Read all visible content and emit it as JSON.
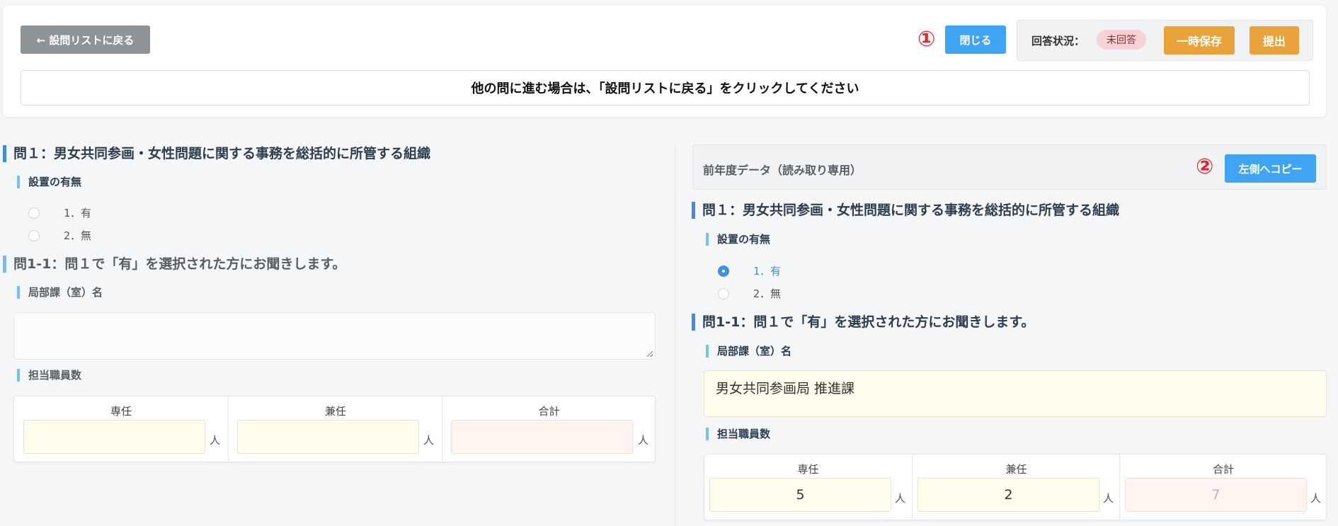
{
  "header": {
    "back_label": "← 設問リストに戻る",
    "marker_1": "①",
    "close_label": "閉じる",
    "status_label": "回答状況：",
    "status_value": "未回答",
    "save_label": "一時保存",
    "submit_label": "提出",
    "notice": "他の問に進む場合は、「設問リストに戻る」をクリックしてください"
  },
  "left": {
    "q1_title": "問１：男女共同参画・女性問題に関する事務を総括的に所管する組織",
    "q1_sub": "設置の有無",
    "q1_options": [
      "1．有",
      "2．無"
    ],
    "q11_title": "問1-1：問１で「有」を選択された方にお聞きします。",
    "dept_label": "局部課（室）名",
    "dept_value": "",
    "staff_label": "担当職員数",
    "staff": {
      "headers": [
        "専任",
        "兼任",
        "合計"
      ],
      "values": [
        "",
        "",
        ""
      ],
      "unit": "人"
    }
  },
  "right": {
    "prev_title": "前年度データ（読み取り専用）",
    "marker_2": "②",
    "copy_label": "左側へコピー",
    "q1_title": "問１：男女共同参画・女性問題に関する事務を総括的に所管する組織",
    "q1_sub": "設置の有無",
    "q1_options": [
      "1．有",
      "2．無"
    ],
    "q1_selected": "1．有",
    "q11_title": "問1-1：問１で「有」を選択された方にお聞きします。",
    "dept_label": "局部課（室）名",
    "dept_value": "男女共同参画局 推進課",
    "staff_label": "担当職員数",
    "staff": {
      "headers": [
        "専任",
        "兼任",
        "合計"
      ],
      "values": [
        "5",
        "2",
        "7"
      ],
      "unit": "人"
    }
  },
  "colors": {
    "primary": "#3fa4f4",
    "warning": "#eaa33a",
    "marker": "#e8242e",
    "badge_bg": "#f7d3d6"
  }
}
